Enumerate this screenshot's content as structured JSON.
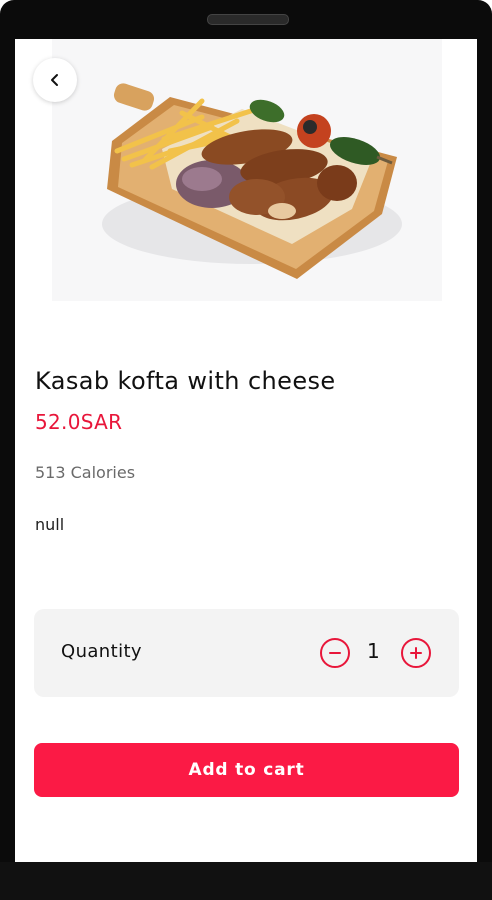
{
  "product": {
    "name": "Kasab kofta with cheese",
    "price": "52.0SAR",
    "calories": "513 Calories",
    "description": "null"
  },
  "quantity": {
    "label": "Quantity",
    "value": "1"
  },
  "actions": {
    "add_to_cart": "Add to cart"
  },
  "icons": {
    "back": "chevron-left-icon",
    "minus": "minus-circle-icon",
    "plus": "plus-circle-icon"
  },
  "colors": {
    "accent": "#e8163a",
    "button": "#fb1a45"
  }
}
